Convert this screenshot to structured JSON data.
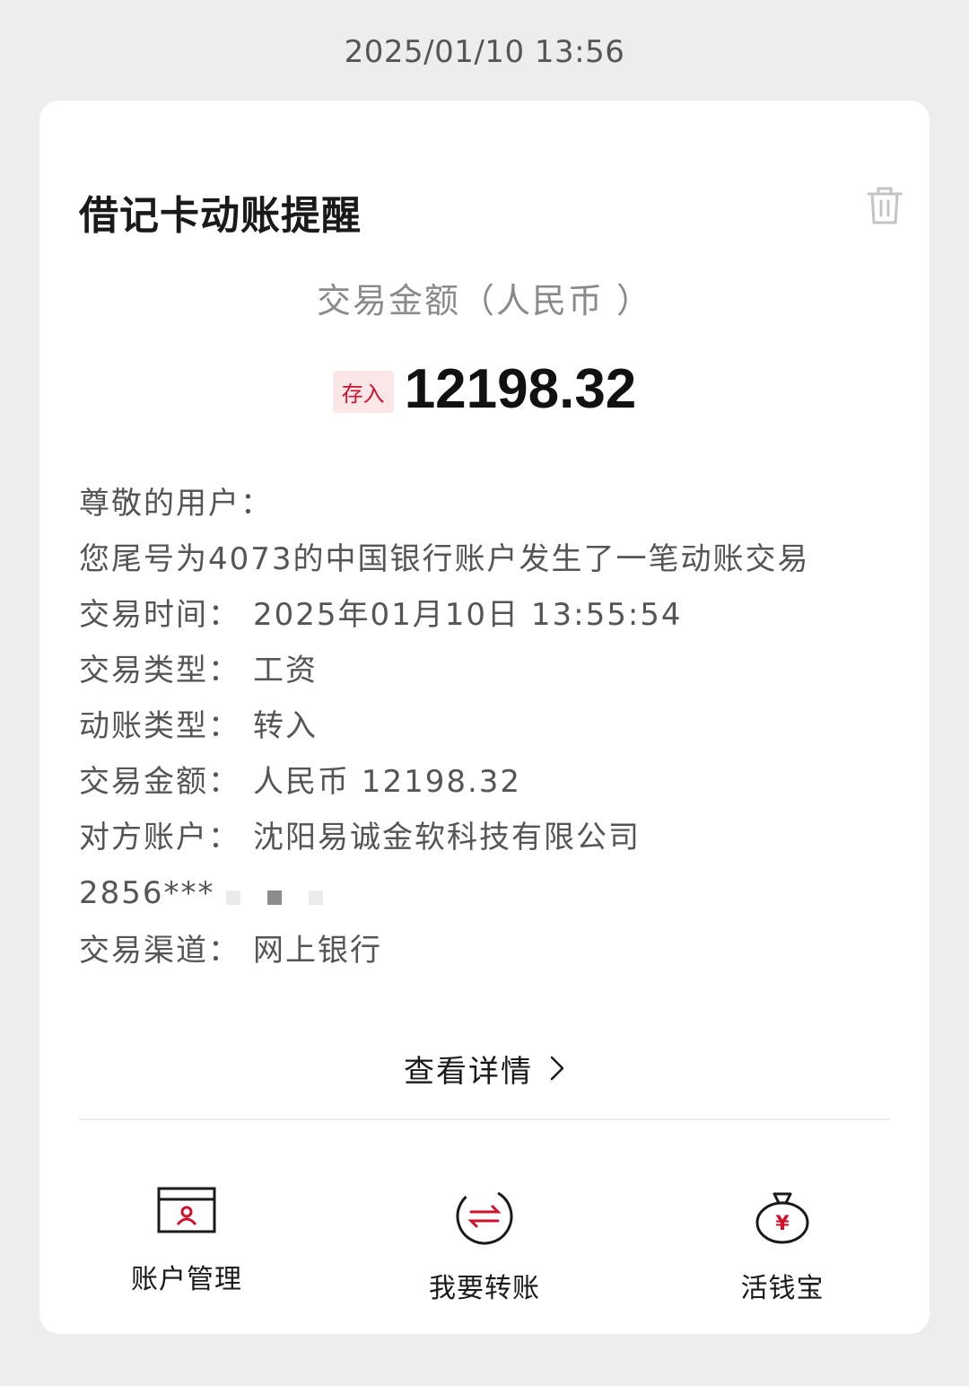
{
  "timestamp": "2025/01/10 13:56",
  "card": {
    "title": "借记卡动账提醒",
    "amount_label": "交易金额（人民币 ）",
    "tag": "存入",
    "amount": "12198.32"
  },
  "details": {
    "greeting": "尊敬的用户：",
    "message": "您尾号为4073的中国银行账户发生了一笔动账交易",
    "time_key": "交易时间：",
    "time_val": "2025年01月10日 13:55:54",
    "type_key": "交易类型：",
    "type_val": "工资",
    "move_key": "动账类型：",
    "move_val": "转入",
    "amt_key": "交易金额：",
    "amt_val": "人民币 12198.32",
    "party_key": "对方账户：",
    "party_val": "沈阳易诚金软科技有限公司",
    "account_masked": "2856***",
    "channel_key": "交易渠道：",
    "channel_val": "网上银行"
  },
  "view_detail": "查看详情",
  "actions": [
    {
      "label": "账户管理",
      "icon": "account-card-icon"
    },
    {
      "label": "我要转账",
      "icon": "transfer-icon"
    },
    {
      "label": "活钱宝",
      "icon": "money-bag-icon"
    }
  ],
  "colors": {
    "accent": "#d0112b",
    "tag_bg": "#fbe6e8"
  }
}
